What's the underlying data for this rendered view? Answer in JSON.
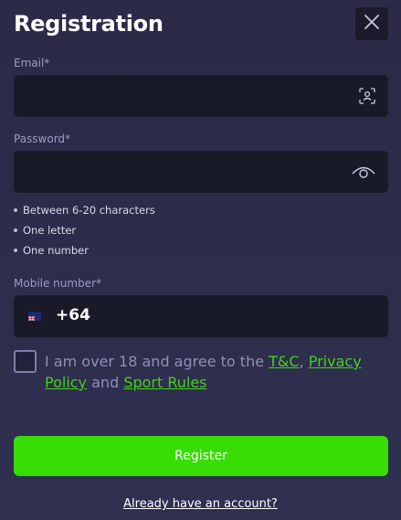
{
  "header": {
    "title": "Registration"
  },
  "icons": {
    "close": "close-icon",
    "email_scan": "face-scan-icon",
    "password_toggle": "eye-icon",
    "flag": "new-zealand-flag-icon"
  },
  "email": {
    "label": "Email*",
    "value": "",
    "placeholder": ""
  },
  "password": {
    "label": "Password*",
    "value": "",
    "placeholder": "",
    "rules": [
      "Between 6-20 characters",
      "One letter",
      "One number"
    ]
  },
  "mobile": {
    "label": "Mobile number*",
    "country_code": "+64"
  },
  "terms": {
    "checked": false,
    "prefix": "I am over 18 and agree to the ",
    "tc_link": "T&C",
    "comma": ", ",
    "privacy_link": "Privacy Policy",
    "and": " and ",
    "sport_rules_link": "Sport Rules"
  },
  "actions": {
    "register_label": "Register",
    "login_link": "Already have an account?"
  },
  "colors": {
    "accent": "#37dd05",
    "link": "#43d11a",
    "background": "#2c2c4a",
    "field": "#191a28"
  }
}
